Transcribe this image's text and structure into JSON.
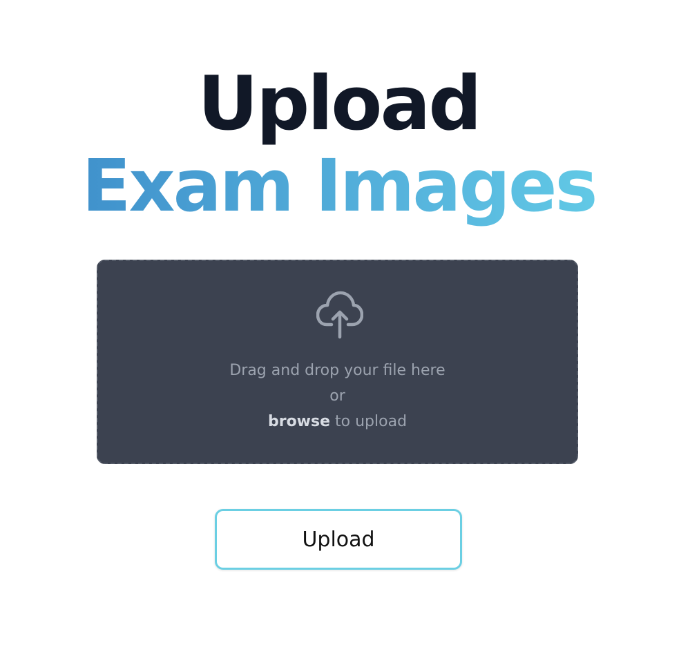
{
  "heading": {
    "line1": "Upload",
    "line2": "Exam Images",
    "line2_gradient": [
      "#3a88c7",
      "#67d3ea"
    ]
  },
  "dropzone": {
    "icon": "cloud-upload-icon",
    "line1": "Drag and drop your file here",
    "line2": "or",
    "browse_label": "browse",
    "line3_suffix": " to upload"
  },
  "upload_button": {
    "label": "Upload",
    "border_color": "#6bcfe3"
  },
  "colors": {
    "title": "#111827",
    "dropzone_bg": "#3c4250",
    "muted_text": "#9ca3af"
  }
}
